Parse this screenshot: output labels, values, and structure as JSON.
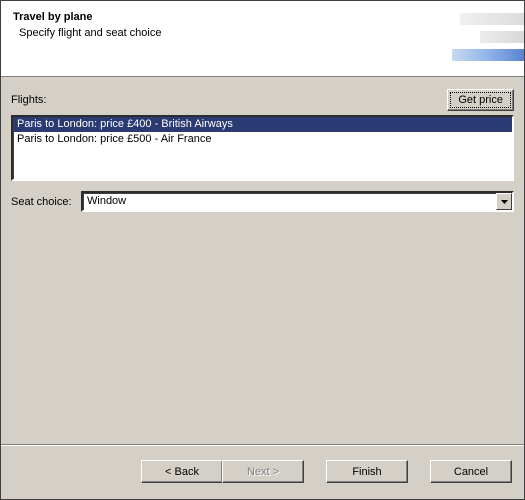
{
  "header": {
    "title": "Travel by plane",
    "subtitle": "Specify flight and seat choice"
  },
  "labels": {
    "flights": "Flights:",
    "seat_choice": "Seat choice:"
  },
  "buttons": {
    "get_price": "Get price",
    "back": "< Back",
    "next": "Next >",
    "finish": "Finish",
    "cancel": "Cancel"
  },
  "flights": {
    "selected_index": 0,
    "items": [
      "Paris to London: price £400 - British Airways",
      "Paris to London: price £500 - Air France"
    ]
  },
  "seat": {
    "value": "Window"
  }
}
